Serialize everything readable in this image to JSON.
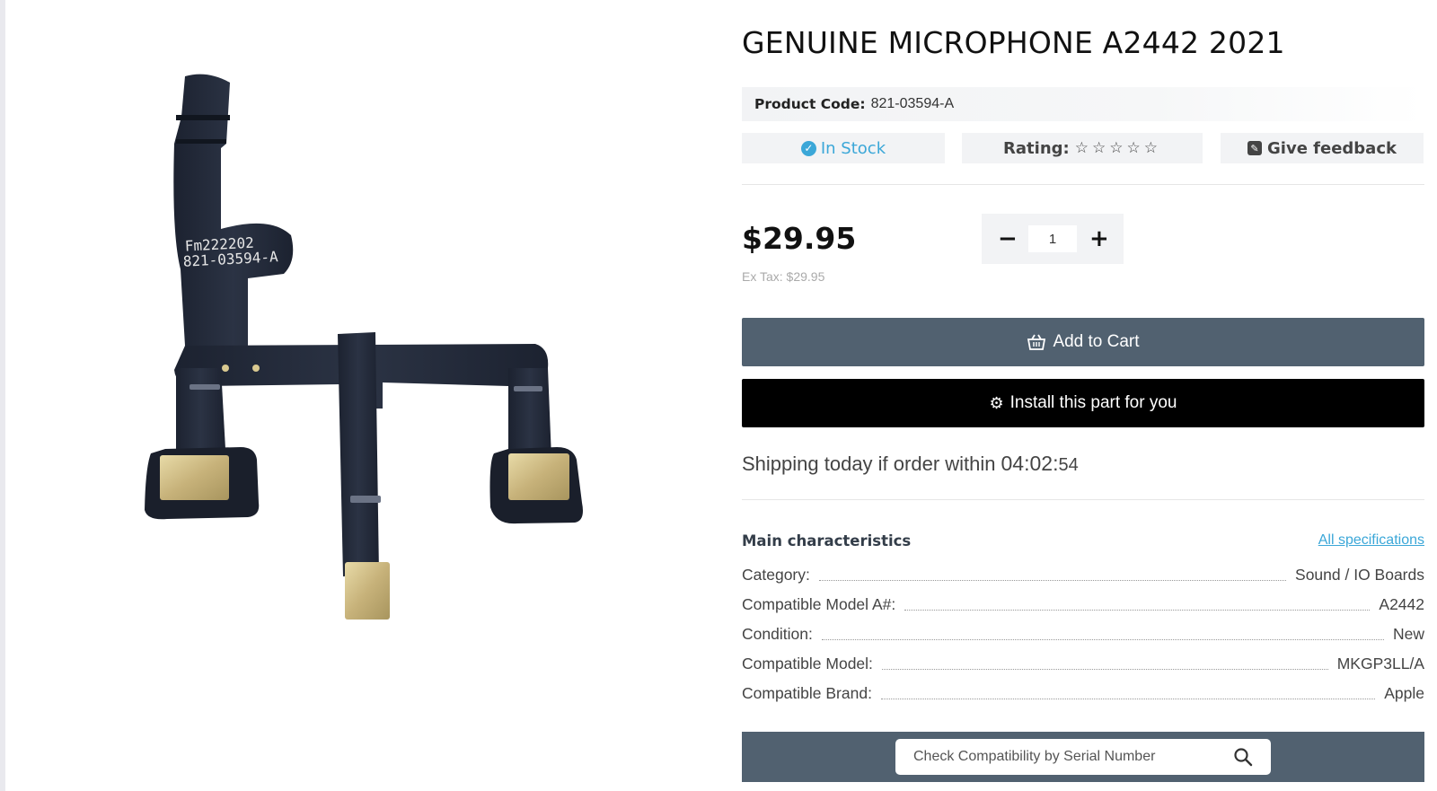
{
  "product": {
    "title": "GENUINE MICROPHONE A2442 2021",
    "code_label": "Product Code:",
    "code_value": "821-03594-A",
    "image_label_line1": "Fm222202",
    "image_label_line2": "821-03594-A"
  },
  "status": {
    "stock": "In Stock",
    "rating_label": "Rating:",
    "rating_stars": "☆☆☆☆☆",
    "rating_value": 0,
    "rating_max": 5,
    "feedback": "Give feedback"
  },
  "pricing": {
    "price": "$29.95",
    "ex_tax": "Ex Tax: $29.95"
  },
  "quantity": {
    "minus": "−",
    "value": "1",
    "plus": "+"
  },
  "actions": {
    "add_to_cart": "Add to Cart",
    "install": "Install this part for you"
  },
  "shipping": {
    "text": "Shipping today if order within",
    "hours": "04",
    "minutes": "02",
    "seconds": "54"
  },
  "characteristics": {
    "heading": "Main characteristics",
    "all_link": "All specifications",
    "rows": [
      {
        "key": "Category:",
        "value": "Sound / IO Boards"
      },
      {
        "key": "Compatible Model A#:",
        "value": "A2442"
      },
      {
        "key": "Condition:",
        "value": "New"
      },
      {
        "key": "Compatible Model:",
        "value": "MKGP3LL/A"
      },
      {
        "key": "Compatible Brand:",
        "value": "Apple"
      }
    ]
  },
  "serial_search": {
    "placeholder": "Check Compatibility by Serial Number"
  },
  "colors": {
    "accent": "#3ba7d8",
    "button_slate": "#516170",
    "button_black": "#000000",
    "pill_bg": "#f2f3f5"
  }
}
